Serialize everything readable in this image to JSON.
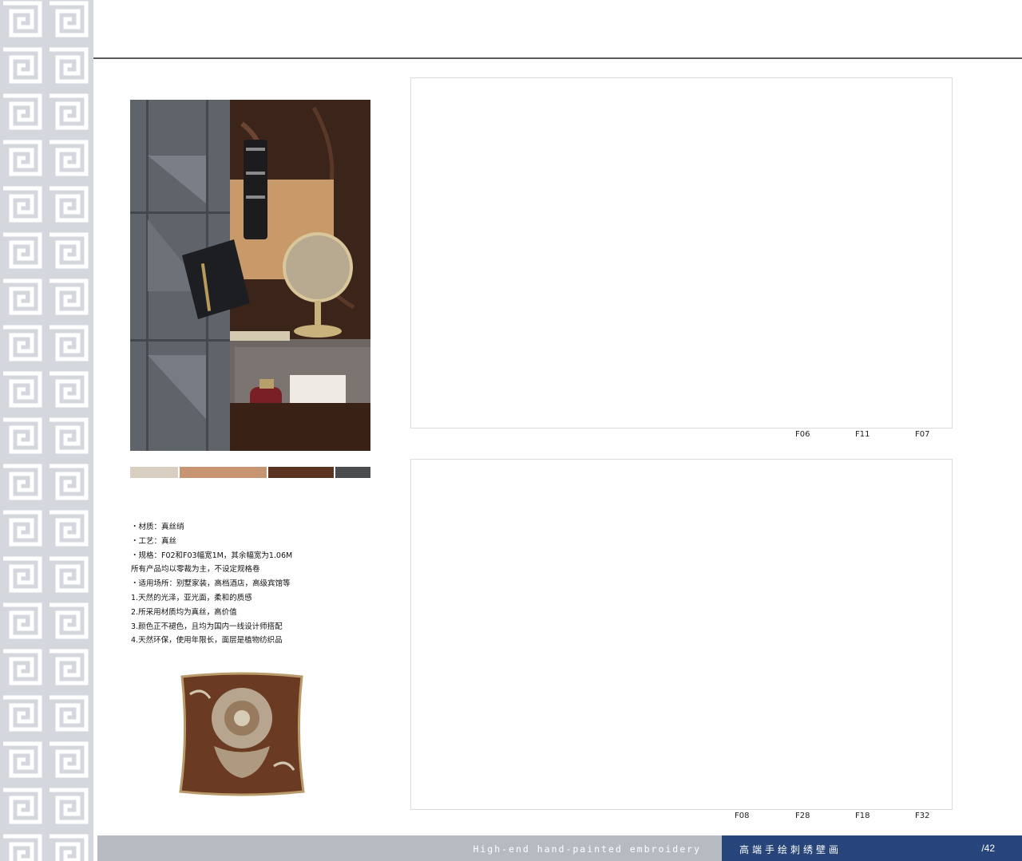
{
  "specs": {
    "lines": [
      "・材质：真丝绡",
      "・工艺：真丝",
      "・规格：F02和F03幅宽1M，其余幅宽为1.06M",
      "所有产品均以零裁为主，不设定规格卷",
      "・适用场所：别墅家装，高档酒店，高级宾馆等",
      "1.天然的光泽，亚光面，柔和的质感",
      "2.所采用材质均为真丝，高价值",
      "3.颜色正不褪色，且均为国内一线设计师搭配",
      "4.天然环保，使用年限长，面层是植物纺织品"
    ]
  },
  "swatches": [
    {
      "color": "#d8cfc0",
      "weight": 60
    },
    {
      "color": "#c79572",
      "weight": 110
    },
    {
      "color": "#5c3222",
      "weight": 83
    },
    {
      "color": "#4c4d50",
      "weight": 44
    }
  ],
  "panels": {
    "top_codes": [
      "F06",
      "F11",
      "F07"
    ],
    "bottom_codes": [
      "F08",
      "F28",
      "F18",
      "F32"
    ]
  },
  "footer": {
    "english": "High-end hand-painted embroidery",
    "chinese": "高端手绘刺绣壁画",
    "page": "/42"
  },
  "colors": {
    "footer_blue": "#27457a",
    "footer_grey": "#b6bbc2",
    "pattern_bg": "#d4d7de"
  },
  "icons": {
    "left_border": "greek-key-pattern",
    "mood_image": "interior-moodboard-photo",
    "pillow": "silk-embroidered-pillow"
  }
}
